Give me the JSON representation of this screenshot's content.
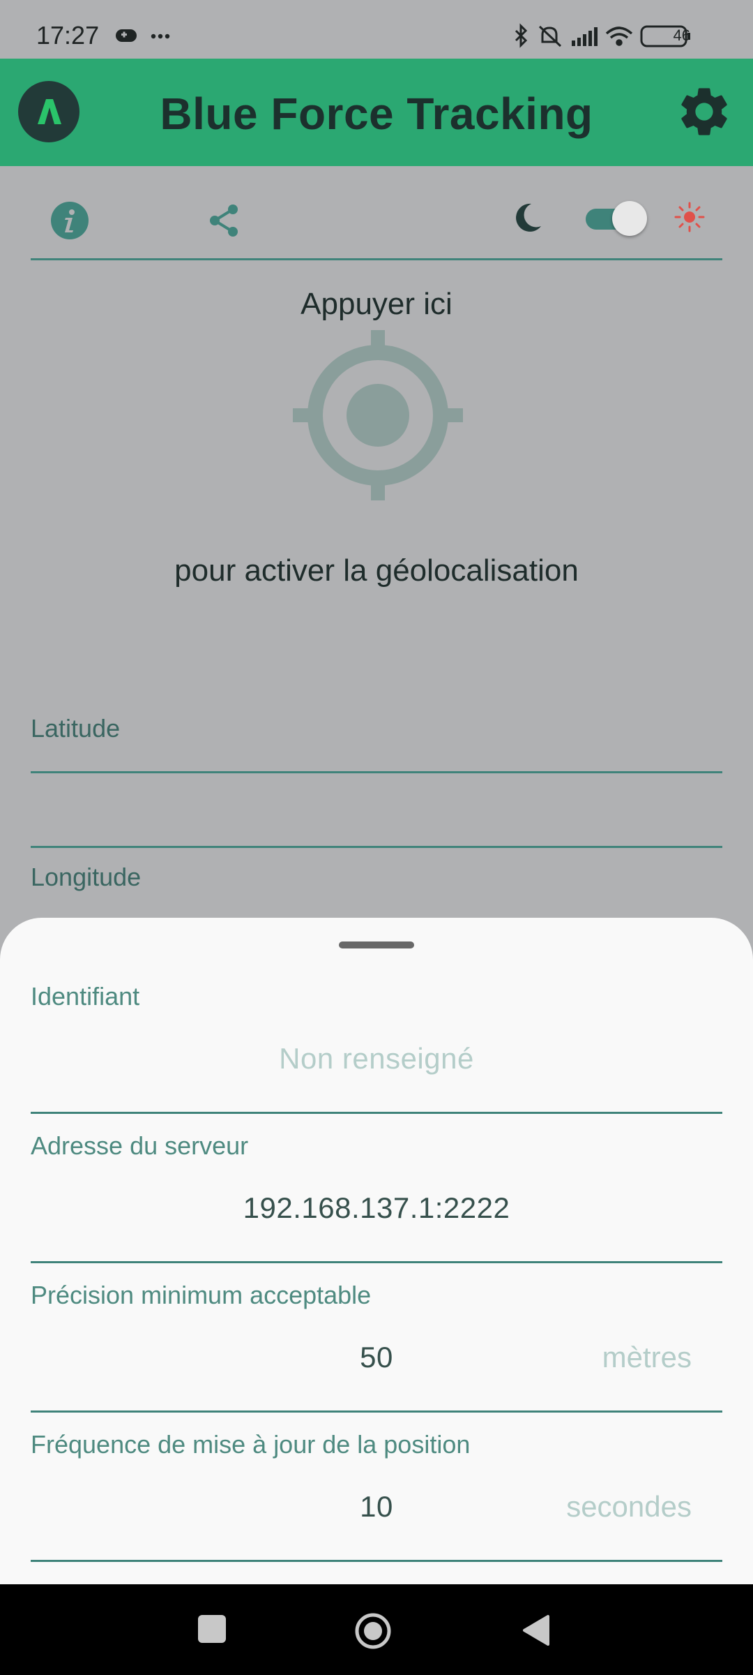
{
  "status_bar": {
    "time": "17:27",
    "battery": "46",
    "left_icons": [
      "game-controller-icon",
      "more-dots-icon"
    ],
    "right_icons": [
      "bluetooth-icon",
      "bell-muted-icon",
      "signal-icon",
      "wifi-icon",
      "battery-icon"
    ]
  },
  "app_bar": {
    "title": "Blue Force Tracking",
    "logo_icon": "app-logo-icon",
    "settings_icon": "gear-icon",
    "color": "#2ba872"
  },
  "toolbar": {
    "icons": [
      "info-icon",
      "share-icon",
      "moon-icon",
      "theme-toggle",
      "sun-icon"
    ],
    "toggle_state": "on"
  },
  "geolocation": {
    "top_text": "Appuyer ici",
    "bottom_text": "pour activer la géolocalisation",
    "icon": "crosshair-icon"
  },
  "coordinates": {
    "latitude_label": "Latitude",
    "longitude_label": "Longitude"
  },
  "settings_sheet": {
    "identifier": {
      "label": "Identifiant",
      "placeholder": "Non renseigné",
      "value": ""
    },
    "server": {
      "label": "Adresse du serveur",
      "value": "192.168.137.1:2222"
    },
    "precision": {
      "label": "Précision minimum acceptable",
      "value": "50",
      "unit": "mètres"
    },
    "frequency": {
      "label": "Fréquence de mise à jour de la position",
      "value": "10",
      "unit": "secondes"
    }
  },
  "nav_bar": {
    "buttons": [
      "recents-button",
      "home-button",
      "back-button"
    ]
  },
  "colors": {
    "accent": "#2ba872",
    "teal": "#3f837a",
    "sun": "#e0514a"
  }
}
